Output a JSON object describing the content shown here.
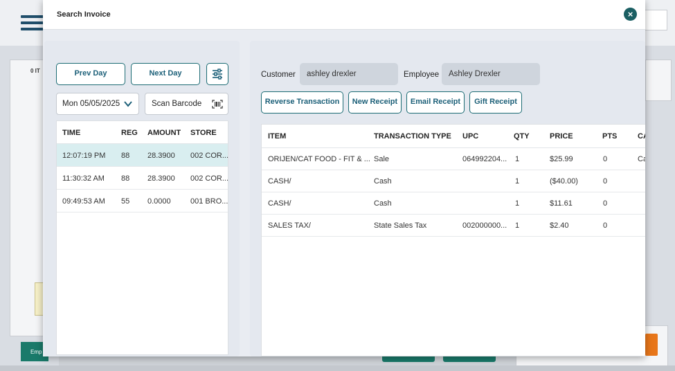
{
  "background": {
    "left_label": "0 IT",
    "emp_tab": "Emp"
  },
  "modal": {
    "title": "Search Invoice",
    "close_glyph": "×"
  },
  "left": {
    "prev_day": "Prev Day",
    "next_day": "Next Day",
    "filter_icon": "sliders-icon",
    "date_value": "Mon 05/05/2025",
    "scan_placeholder": "Scan Barcode",
    "columns": [
      "TIME",
      "REG",
      "AMOUNT",
      "STORE"
    ],
    "rows": [
      {
        "time": "12:07:19 PM",
        "reg": "88",
        "amount": "28.3900",
        "store": "002 COR..."
      },
      {
        "time": "11:30:32 AM",
        "reg": "88",
        "amount": "28.3900",
        "store": "002 COR..."
      },
      {
        "time": "09:49:53 AM",
        "reg": "55",
        "amount": "0.0000",
        "store": "001 BRO..."
      }
    ]
  },
  "right": {
    "customer_label": "Customer",
    "customer_value": "ashley drexler",
    "employee_label": "Employee",
    "employee_value": "Ashley Drexler",
    "buttons": {
      "reverse": "Reverse Transaction",
      "new_receipt": "New Receipt",
      "email_receipt": "Email Receipt",
      "gift_receipt": "Gift Receipt"
    },
    "columns": [
      "ITEM",
      "TRANSACTION TYPE",
      "UPC",
      "QTY",
      "PRICE",
      "PTS",
      "CA"
    ],
    "rows": [
      {
        "item": "ORIJEN/CAT FOOD - FIT & ...",
        "type": "Sale",
        "upc": "064992204...",
        "qty": "1",
        "price": "$25.99",
        "pts": "0",
        "ca": "Ca"
      },
      {
        "item": "CASH/",
        "type": "Cash",
        "upc": "",
        "qty": "1",
        "price": "($40.00)",
        "pts": "0",
        "ca": ""
      },
      {
        "item": "CASH/",
        "type": "Cash",
        "upc": "",
        "qty": "1",
        "price": "$11.61",
        "pts": "0",
        "ca": ""
      },
      {
        "item": "SALES TAX/",
        "type": "State Sales Tax",
        "upc": "002000000...",
        "qty": "1",
        "price": "$2.40",
        "pts": "0",
        "ca": ""
      }
    ]
  },
  "colors": {
    "teal_dark": "#1b5f63",
    "selected_row": "#d9eef0",
    "accent_orange": "#e8761a"
  }
}
